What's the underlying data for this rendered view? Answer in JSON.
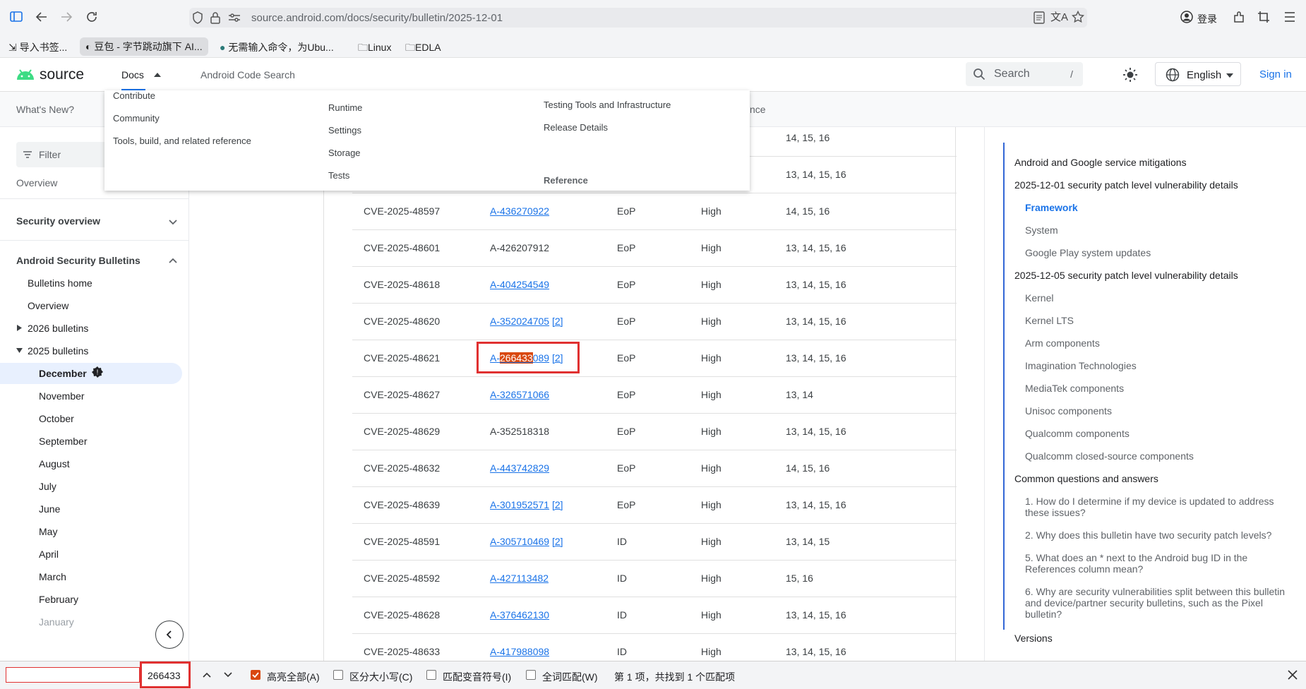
{
  "browser": {
    "url": "source.android.com/docs/security/bulletin/2025-12-01",
    "login_label": "登录",
    "bookmarks": [
      "导入书签...",
      "豆包 - 字节跳动旗下 AI...",
      "无需输入命令，为Ubu...",
      "Linux",
      "EDLA"
    ]
  },
  "header": {
    "logo": "source",
    "nav_docs": "Docs",
    "nav_code_search": "Android Code Search",
    "search_placeholder": "Search",
    "search_shortcut": "/",
    "language": "English",
    "sign_in": "Sign in"
  },
  "subnav": {
    "whats_new": "What's New?",
    "ref_fragment": "nce"
  },
  "dropdown": {
    "col1": [
      "Contribute",
      "Community",
      "Tools, build, and related reference"
    ],
    "col2": [
      "Runtime",
      "Settings",
      "Storage",
      "Tests"
    ],
    "col3": [
      "Testing Tools and Infrastructure",
      "Release Details"
    ],
    "col3_heading": "Reference"
  },
  "sidebar": {
    "filter_placeholder": "Filter",
    "cut_item": "Overview",
    "security_overview": "Security overview",
    "bulletins_section": "Android Security Bulletins",
    "items": [
      "Bulletins home",
      "Overview"
    ],
    "year_2026": "2026 bulletins",
    "year_2025": "2025 bulletins",
    "months": [
      "December",
      "November",
      "October",
      "September",
      "August",
      "July",
      "June",
      "May",
      "April",
      "March",
      "February",
      "January"
    ]
  },
  "table": {
    "top_rows": [
      {
        "versions": "14, 15, 16"
      },
      {
        "versions": "13, 14, 15, 16"
      }
    ],
    "rows": [
      {
        "cve": "CVE-2025-48597",
        "ref": "A-436270922",
        "ref_link": true,
        "extra": "",
        "type": "EoP",
        "severity": "High",
        "versions": "14, 15, 16"
      },
      {
        "cve": "CVE-2025-48601",
        "ref": "A-426207912",
        "ref_link": false,
        "extra": "",
        "type": "EoP",
        "severity": "High",
        "versions": "13, 14, 15, 16"
      },
      {
        "cve": "CVE-2025-48618",
        "ref": "A-404254549",
        "ref_link": true,
        "extra": "",
        "type": "EoP",
        "severity": "High",
        "versions": "13, 14, 15, 16"
      },
      {
        "cve": "CVE-2025-48620",
        "ref": "A-352024705",
        "ref_link": true,
        "extra": "[2]",
        "type": "EoP",
        "severity": "High",
        "versions": "13, 14, 15, 16"
      },
      {
        "cve": "CVE-2025-48621",
        "ref": "A-266433089",
        "ref_link": true,
        "extra": "[2]",
        "type": "EoP",
        "severity": "High",
        "versions": "13, 14, 15, 16",
        "match_prefix": "A-",
        "match": "266433",
        "match_suffix": "089"
      },
      {
        "cve": "CVE-2025-48627",
        "ref": "A-326571066",
        "ref_link": true,
        "extra": "",
        "type": "EoP",
        "severity": "High",
        "versions": "13, 14"
      },
      {
        "cve": "CVE-2025-48629",
        "ref": "A-352518318",
        "ref_link": false,
        "extra": "",
        "type": "EoP",
        "severity": "High",
        "versions": "13, 14, 15, 16"
      },
      {
        "cve": "CVE-2025-48632",
        "ref": "A-443742829",
        "ref_link": true,
        "extra": "",
        "type": "EoP",
        "severity": "High",
        "versions": "14, 15, 16"
      },
      {
        "cve": "CVE-2025-48639",
        "ref": "A-301952571",
        "ref_link": true,
        "extra": "[2]",
        "type": "EoP",
        "severity": "High",
        "versions": "13, 14, 15, 16"
      },
      {
        "cve": "CVE-2025-48591",
        "ref": "A-305710469",
        "ref_link": true,
        "extra": "[2]",
        "type": "ID",
        "severity": "High",
        "versions": "13, 14, 15"
      },
      {
        "cve": "CVE-2025-48592",
        "ref": "A-427113482",
        "ref_link": true,
        "extra": "",
        "type": "ID",
        "severity": "High",
        "versions": "15, 16"
      },
      {
        "cve": "CVE-2025-48628",
        "ref": "A-376462130",
        "ref_link": true,
        "extra": "",
        "type": "ID",
        "severity": "High",
        "versions": "13, 14, 15, 16"
      },
      {
        "cve": "CVE-2025-48633",
        "ref": "A-417988098",
        "ref_link": true,
        "extra": "",
        "type": "ID",
        "severity": "High",
        "versions": "13, 14, 15, 16"
      }
    ]
  },
  "toc": {
    "items": [
      {
        "text": "Android and Google service mitigations",
        "level": 1
      },
      {
        "text": "2025-12-01 security patch level vulnerability details",
        "level": 1
      },
      {
        "text": "Framework",
        "level": 2,
        "active": true
      },
      {
        "text": "System",
        "level": 2
      },
      {
        "text": "Google Play system updates",
        "level": 2
      },
      {
        "text": "2025-12-05 security patch level vulnerability details",
        "level": 1
      },
      {
        "text": "Kernel",
        "level": 2
      },
      {
        "text": "Kernel LTS",
        "level": 2
      },
      {
        "text": "Arm components",
        "level": 2
      },
      {
        "text": "Imagination Technologies",
        "level": 2
      },
      {
        "text": "MediaTek components",
        "level": 2
      },
      {
        "text": "Unisoc components",
        "level": 2
      },
      {
        "text": "Qualcomm components",
        "level": 2
      },
      {
        "text": "Qualcomm closed-source components",
        "level": 2
      },
      {
        "text": "Common questions and answers",
        "level": 1
      },
      {
        "text": "1. How do I determine if my device is updated to address these issues?",
        "level": 2
      },
      {
        "text": "2. Why does this bulletin have two security patch levels?",
        "level": 2
      },
      {
        "text": "5. What does an * next to the Android bug ID in the References column mean?",
        "level": 2
      },
      {
        "text": "6. Why are security vulnerabilities split between this bulletin and device/partner security bulletins, such as the Pixel bulletin?",
        "level": 2
      },
      {
        "text": "Versions",
        "level": 1
      }
    ]
  },
  "findbar": {
    "query": "266433",
    "highlight_all": "高亮全部(A)",
    "match_case": "区分大小写(C)",
    "match_diacritics": "匹配变音符号(I)",
    "whole_words": "全词匹配(W)",
    "result": "第 1 项，共找到 1 个匹配项"
  },
  "colors": {
    "accent": "#1a73e8",
    "highlight": "#d9480f",
    "annotation": "#e03131",
    "logo_green": "#3ddc84"
  }
}
